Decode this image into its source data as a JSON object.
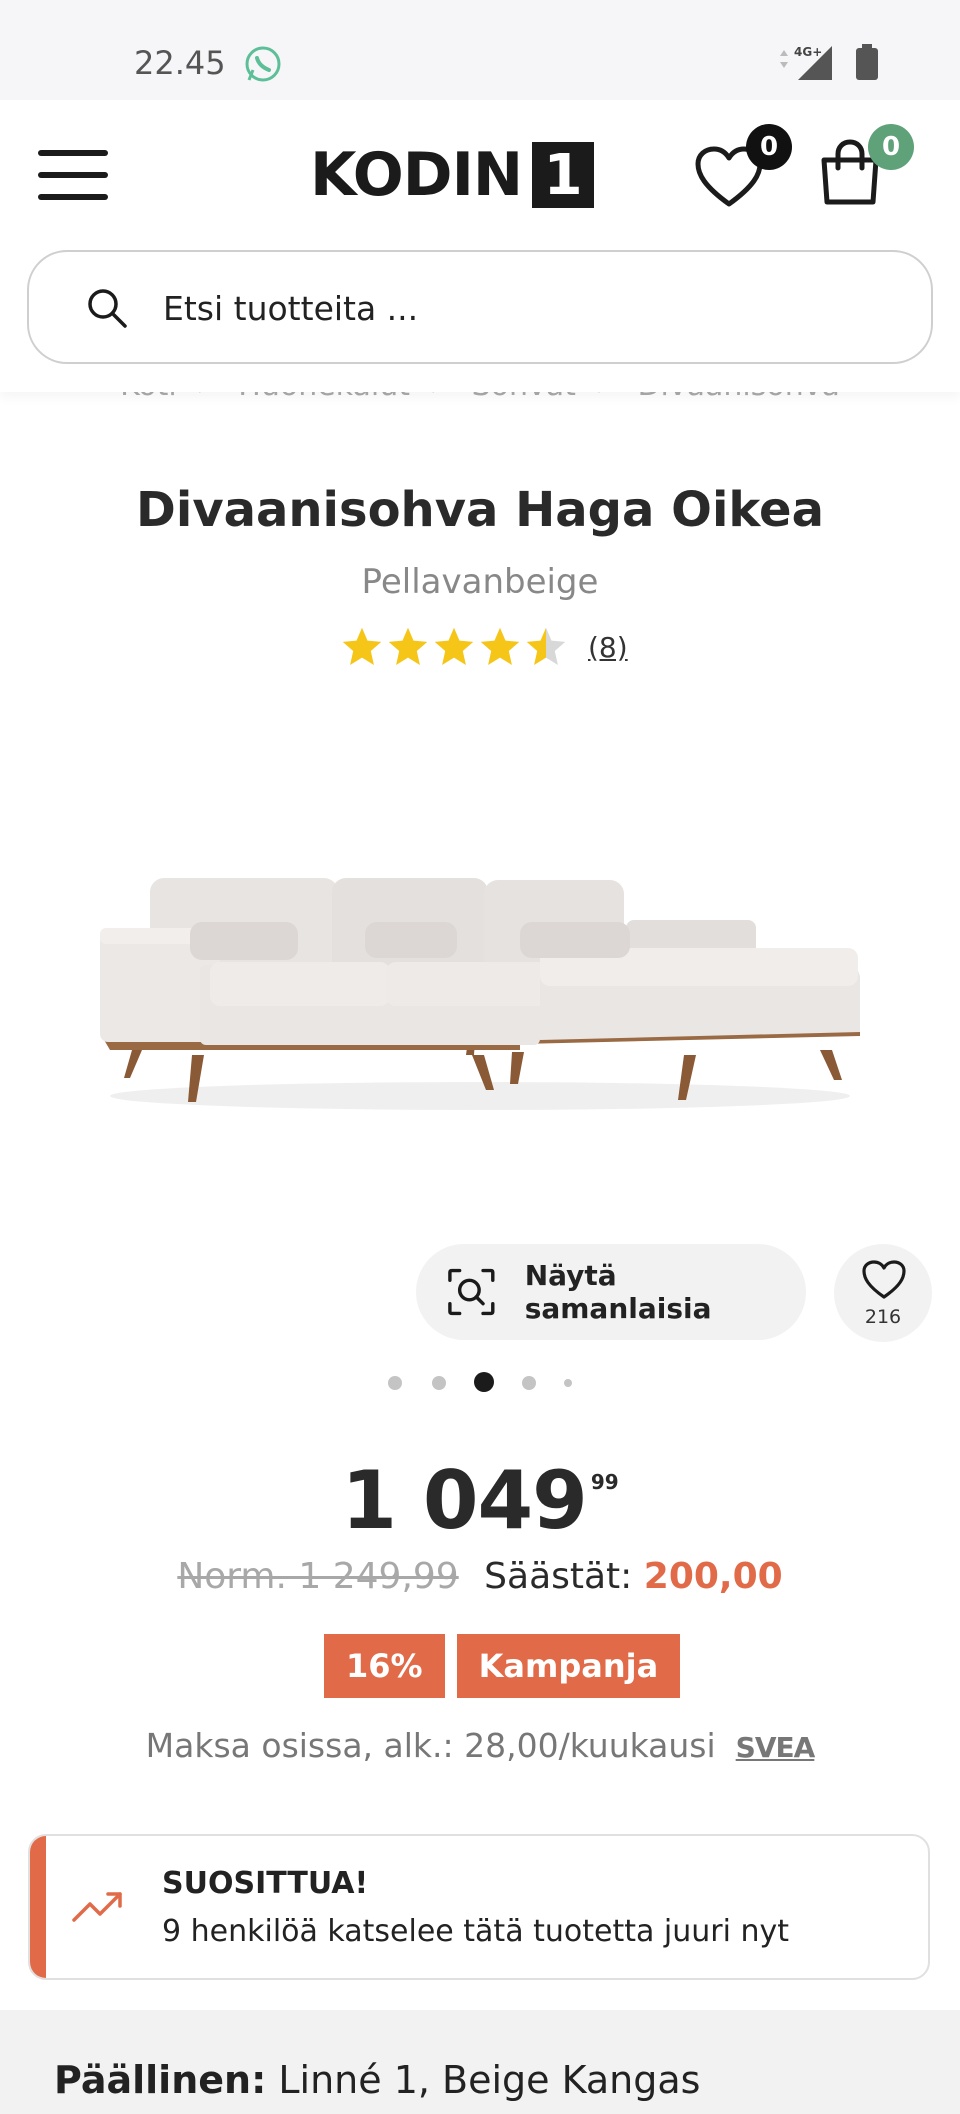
{
  "status_bar": {
    "time": "22.45",
    "network": "4G+"
  },
  "header": {
    "logo_text": "KODIN",
    "logo_number": "1",
    "wishlist_count": "0",
    "cart_count": "0"
  },
  "search": {
    "placeholder": "Etsi tuotteita ..."
  },
  "breadcrumb": [
    "Koti",
    "Huonekalut",
    "Sohvat",
    "Divaanisohva"
  ],
  "product": {
    "title": "Divaanisohva Haga Oikea",
    "variant": "Pellavanbeige",
    "rating": 4.5,
    "review_count": "(8)"
  },
  "actions": {
    "similar_label": "Näytä samanlaisia",
    "favorite_count": "216"
  },
  "carousel": {
    "total": 5,
    "active": 3
  },
  "price": {
    "main": "1 049",
    "cents": "99",
    "norm": "Norm. 1 249,99",
    "save_label": "Säästät:",
    "save_amount": "200,00",
    "tags": [
      "16%",
      "Kampanja"
    ],
    "installment": "Maksa osissa, alk.: 28,00/kuukausi",
    "installment_provider": "SVEA"
  },
  "popular": {
    "title": "SUOSITTUA!",
    "text": "9 henkilöä katselee tätä tuotetta juuri nyt"
  },
  "spec": {
    "label": "Päällinen:",
    "value": "Linné 1, Beige Kangas"
  },
  "colors": {
    "accent": "#e16b48",
    "cart_badge": "#5fa27a",
    "star": "#f5c518"
  }
}
